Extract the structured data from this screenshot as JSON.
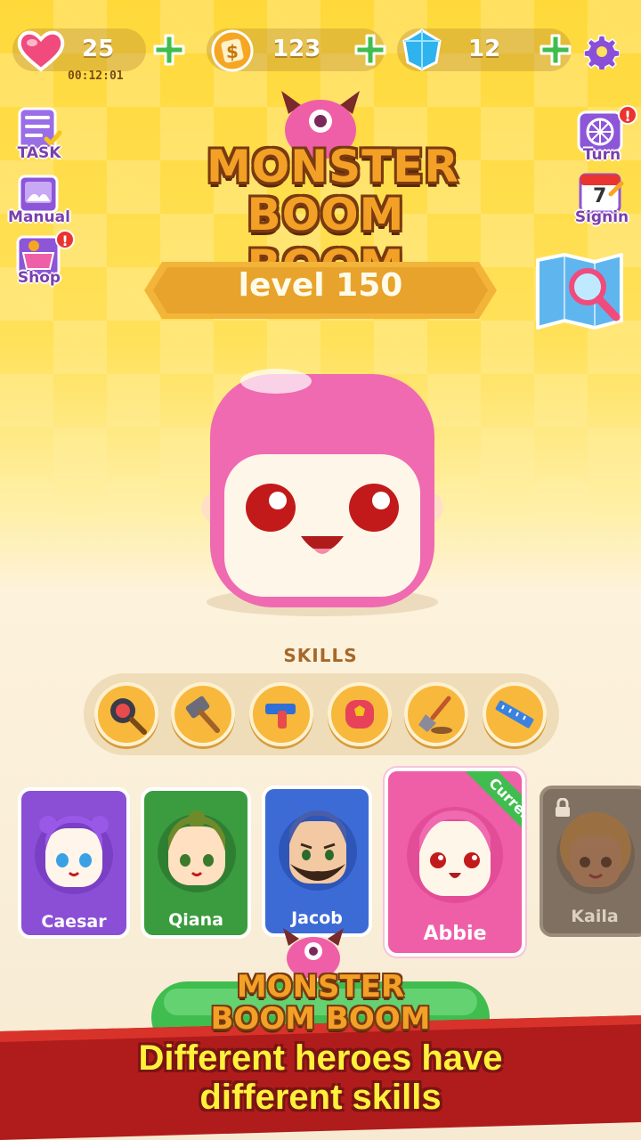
{
  "hud": {
    "lives": "25",
    "timer": "00:12:01",
    "coins": "123",
    "gems": "12"
  },
  "side_left": {
    "task": "TASK",
    "manual": "Manual",
    "shop": "Shop",
    "shop_badge": "!"
  },
  "side_right": {
    "turn": "Turn",
    "turn_badge": "!",
    "signin": "Signin",
    "signin_day": "7"
  },
  "logo": {
    "line1": "MONSTER",
    "line2": "BOOM BOOM"
  },
  "level": "level 150",
  "skills": {
    "title": "SKILLS",
    "items": [
      "frying-pan",
      "hammer",
      "pistol",
      "boxing-glove",
      "shovel",
      "ruler"
    ]
  },
  "heroes": [
    {
      "name": "Caesar",
      "color": "#8b4fd6"
    },
    {
      "name": "Qiana",
      "color": "#3b9c3f"
    },
    {
      "name": "Jacob",
      "color": "#3d6bd6"
    },
    {
      "name": "Abbie",
      "color": "#ef5fa8",
      "tag": "Current"
    },
    {
      "name": "Kaila",
      "color": "#6b5b4d",
      "locked": true
    }
  ],
  "promo": {
    "logo_line1": "MONSTER",
    "logo_line2": "BOOM BOOM",
    "tagline_line1": "Different heroes have",
    "tagline_line2": "different skills"
  },
  "colors": {
    "accent_purple": "#7a3fae",
    "heart_pink": "#f04b7c",
    "plus_green": "#3fbd4e",
    "banner_red": "#b01c1c"
  }
}
